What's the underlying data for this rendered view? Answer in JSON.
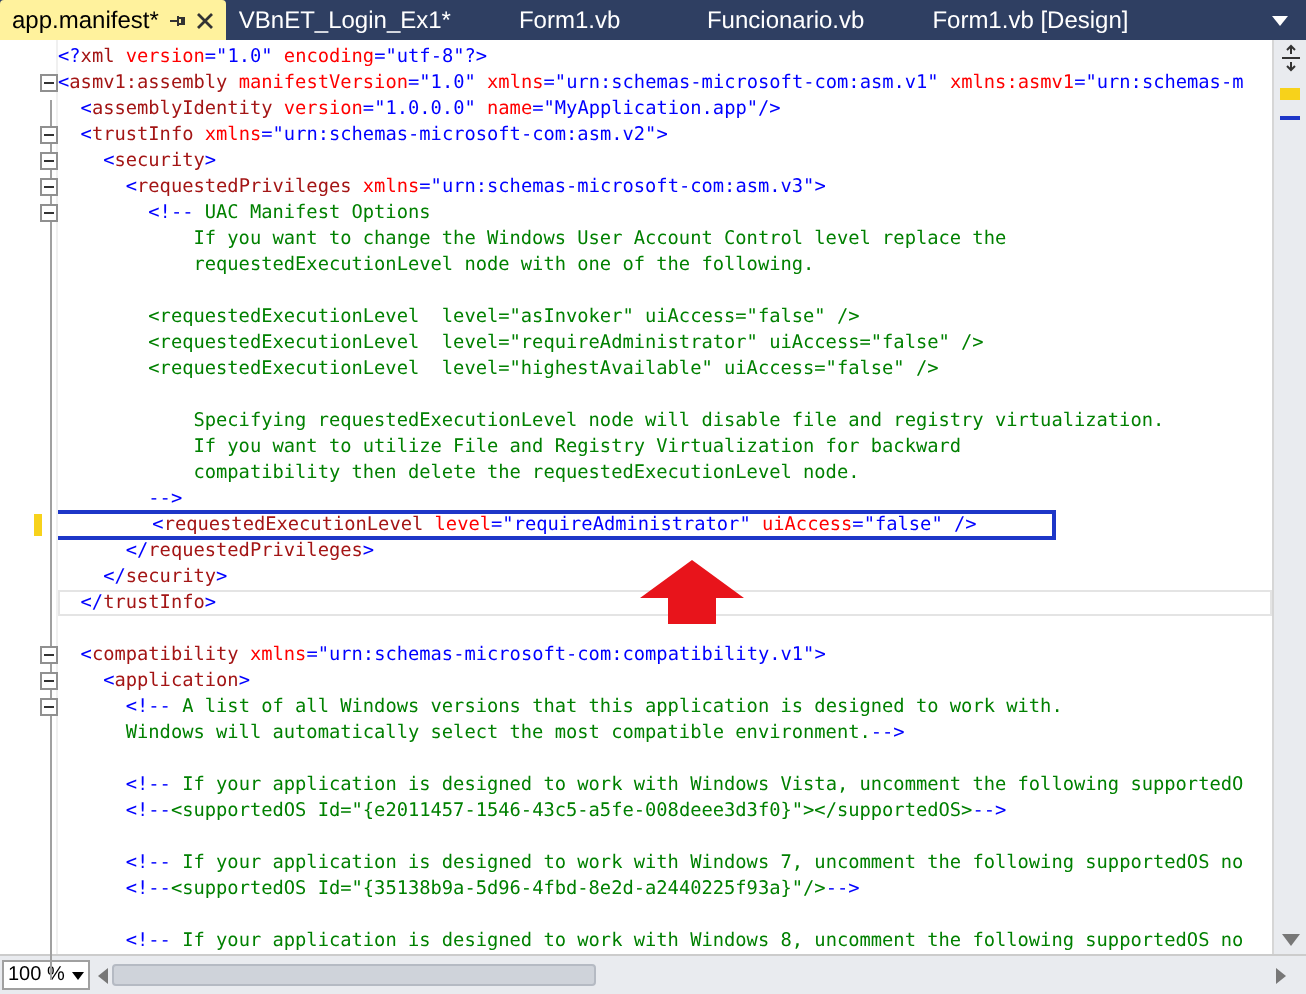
{
  "tabs": [
    {
      "label": "app.manifest*",
      "selected": true
    },
    {
      "label": "VBnET_Login_Ex1*",
      "selected": false
    },
    {
      "label": "Form1.vb",
      "selected": false
    },
    {
      "label": "Funcionario.vb",
      "selected": false
    },
    {
      "label": "Form1.vb [Design]",
      "selected": false
    }
  ],
  "editor": {
    "lines": [
      {
        "fold": false,
        "changed": false,
        "boxed": false,
        "current": false,
        "tokens": [
          {
            "kind": "delim",
            "text": "<?"
          },
          {
            "kind": "tag",
            "text": "xml"
          },
          {
            "kind": "attr",
            "text": " version"
          },
          {
            "kind": "delim",
            "text": "="
          },
          {
            "kind": "value",
            "text": "\"1.0\""
          },
          {
            "kind": "attr",
            "text": " encoding"
          },
          {
            "kind": "delim",
            "text": "="
          },
          {
            "kind": "value",
            "text": "\"utf-8\""
          },
          {
            "kind": "delim",
            "text": "?>"
          }
        ]
      },
      {
        "fold": true,
        "changed": false,
        "boxed": false,
        "current": false,
        "tokens": [
          {
            "kind": "delim",
            "text": "<"
          },
          {
            "kind": "tag",
            "text": "asmv1:assembly"
          },
          {
            "kind": "attr",
            "text": " manifestVersion"
          },
          {
            "kind": "delim",
            "text": "="
          },
          {
            "kind": "value",
            "text": "\"1.0\""
          },
          {
            "kind": "attr",
            "text": " xmlns"
          },
          {
            "kind": "delim",
            "text": "="
          },
          {
            "kind": "value",
            "text": "\"urn:schemas-microsoft-com:asm.v1\""
          },
          {
            "kind": "attr",
            "text": " xmlns:asmv1"
          },
          {
            "kind": "delim",
            "text": "="
          },
          {
            "kind": "value",
            "text": "\"urn:schemas-m"
          }
        ]
      },
      {
        "fold": false,
        "changed": false,
        "boxed": false,
        "current": false,
        "tokens": [
          {
            "kind": "delim",
            "text": "  <"
          },
          {
            "kind": "tag",
            "text": "assemblyIdentity"
          },
          {
            "kind": "attr",
            "text": " version"
          },
          {
            "kind": "delim",
            "text": "="
          },
          {
            "kind": "value",
            "text": "\"1.0.0.0\""
          },
          {
            "kind": "attr",
            "text": " name"
          },
          {
            "kind": "delim",
            "text": "="
          },
          {
            "kind": "value",
            "text": "\"MyApplication.app\""
          },
          {
            "kind": "delim",
            "text": "/>"
          }
        ]
      },
      {
        "fold": true,
        "changed": false,
        "boxed": false,
        "current": false,
        "tokens": [
          {
            "kind": "delim",
            "text": "  <"
          },
          {
            "kind": "tag",
            "text": "trustInfo"
          },
          {
            "kind": "attr",
            "text": " xmlns"
          },
          {
            "kind": "delim",
            "text": "="
          },
          {
            "kind": "value",
            "text": "\"urn:schemas-microsoft-com:asm.v2\""
          },
          {
            "kind": "delim",
            "text": ">"
          }
        ]
      },
      {
        "fold": true,
        "changed": false,
        "boxed": false,
        "current": false,
        "tokens": [
          {
            "kind": "delim",
            "text": "    <"
          },
          {
            "kind": "tag",
            "text": "security"
          },
          {
            "kind": "delim",
            "text": ">"
          }
        ]
      },
      {
        "fold": true,
        "changed": false,
        "boxed": false,
        "current": false,
        "tokens": [
          {
            "kind": "delim",
            "text": "      <"
          },
          {
            "kind": "tag",
            "text": "requestedPrivileges"
          },
          {
            "kind": "attr",
            "text": " xmlns"
          },
          {
            "kind": "delim",
            "text": "="
          },
          {
            "kind": "value",
            "text": "\"urn:schemas-microsoft-com:asm.v3\""
          },
          {
            "kind": "delim",
            "text": ">"
          }
        ]
      },
      {
        "fold": true,
        "changed": false,
        "boxed": false,
        "current": false,
        "tokens": [
          {
            "kind": "delim",
            "text": "        <!--"
          },
          {
            "kind": "comment",
            "text": " UAC Manifest Options"
          }
        ]
      },
      {
        "fold": false,
        "changed": false,
        "boxed": false,
        "current": false,
        "tokens": [
          {
            "kind": "comment",
            "text": "            If you want to change the Windows User Account Control level replace the"
          }
        ]
      },
      {
        "fold": false,
        "changed": false,
        "boxed": false,
        "current": false,
        "tokens": [
          {
            "kind": "comment",
            "text": "            requestedExecutionLevel node with one of the following."
          }
        ]
      },
      {
        "fold": false,
        "changed": false,
        "boxed": false,
        "current": false
      },
      {
        "fold": false,
        "changed": false,
        "boxed": false,
        "current": false,
        "tokens": [
          {
            "kind": "comment",
            "text": "        <requestedExecutionLevel  level=\"asInvoker\" uiAccess=\"false\" />"
          }
        ]
      },
      {
        "fold": false,
        "changed": false,
        "boxed": false,
        "current": false,
        "tokens": [
          {
            "kind": "comment",
            "text": "        <requestedExecutionLevel  level=\"requireAdministrator\" uiAccess=\"false\" />"
          }
        ]
      },
      {
        "fold": false,
        "changed": false,
        "boxed": false,
        "current": false,
        "tokens": [
          {
            "kind": "comment",
            "text": "        <requestedExecutionLevel  level=\"highestAvailable\" uiAccess=\"false\" />"
          }
        ]
      },
      {
        "fold": false,
        "changed": false,
        "boxed": false,
        "current": false
      },
      {
        "fold": false,
        "changed": false,
        "boxed": false,
        "current": false,
        "tokens": [
          {
            "kind": "comment",
            "text": "            Specifying requestedExecutionLevel node will disable file and registry virtualization."
          }
        ]
      },
      {
        "fold": false,
        "changed": false,
        "boxed": false,
        "current": false,
        "tokens": [
          {
            "kind": "comment",
            "text": "            If you want to utilize File and Registry Virtualization for backward"
          }
        ]
      },
      {
        "fold": false,
        "changed": false,
        "boxed": false,
        "current": false,
        "tokens": [
          {
            "kind": "comment",
            "text": "            compatibility then delete the requestedExecutionLevel node."
          }
        ]
      },
      {
        "fold": false,
        "changed": false,
        "boxed": false,
        "current": false,
        "tokens": [
          {
            "kind": "delim",
            "text": "        -->"
          }
        ]
      },
      {
        "fold": false,
        "changed": true,
        "boxed": true,
        "current": false,
        "tokens": [
          {
            "kind": "delim",
            "text": "        <"
          },
          {
            "kind": "tag",
            "text": "requestedExecutionLevel"
          },
          {
            "kind": "attr",
            "text": " level"
          },
          {
            "kind": "delim",
            "text": "="
          },
          {
            "kind": "value",
            "text": "\"requireAdministrator\""
          },
          {
            "kind": "attr",
            "text": " uiAccess"
          },
          {
            "kind": "delim",
            "text": "="
          },
          {
            "kind": "value",
            "text": "\"false\""
          },
          {
            "kind": "delim",
            "text": " />"
          }
        ]
      },
      {
        "fold": false,
        "changed": false,
        "boxed": false,
        "current": false,
        "tokens": [
          {
            "kind": "delim",
            "text": "      </"
          },
          {
            "kind": "tag",
            "text": "requestedPrivileges"
          },
          {
            "kind": "delim",
            "text": ">"
          }
        ]
      },
      {
        "fold": false,
        "changed": false,
        "boxed": false,
        "current": false,
        "tokens": [
          {
            "kind": "delim",
            "text": "    </"
          },
          {
            "kind": "tag",
            "text": "security"
          },
          {
            "kind": "delim",
            "text": ">"
          }
        ]
      },
      {
        "fold": false,
        "changed": false,
        "boxed": false,
        "current": true,
        "tokens": [
          {
            "kind": "delim",
            "text": "  </"
          },
          {
            "kind": "tag",
            "text": "trustInfo"
          },
          {
            "kind": "delim",
            "text": ">"
          }
        ]
      },
      {
        "fold": false,
        "changed": false,
        "boxed": false,
        "current": false
      },
      {
        "fold": true,
        "changed": false,
        "boxed": false,
        "current": false,
        "tokens": [
          {
            "kind": "delim",
            "text": "  <"
          },
          {
            "kind": "tag",
            "text": "compatibility"
          },
          {
            "kind": "attr",
            "text": " xmlns"
          },
          {
            "kind": "delim",
            "text": "="
          },
          {
            "kind": "value",
            "text": "\"urn:schemas-microsoft-com:compatibility.v1\""
          },
          {
            "kind": "delim",
            "text": ">"
          }
        ]
      },
      {
        "fold": true,
        "changed": false,
        "boxed": false,
        "current": false,
        "tokens": [
          {
            "kind": "delim",
            "text": "    <"
          },
          {
            "kind": "tag",
            "text": "application"
          },
          {
            "kind": "delim",
            "text": ">"
          }
        ]
      },
      {
        "fold": true,
        "changed": false,
        "boxed": false,
        "current": false,
        "tokens": [
          {
            "kind": "delim",
            "text": "      <!--"
          },
          {
            "kind": "comment",
            "text": " A list of all Windows versions that this application is designed to work with."
          }
        ]
      },
      {
        "fold": false,
        "changed": false,
        "boxed": false,
        "current": false,
        "tokens": [
          {
            "kind": "comment",
            "text": "      Windows will automatically select the most compatible environment."
          },
          {
            "kind": "delim",
            "text": "-->"
          }
        ]
      },
      {
        "fold": false,
        "changed": false,
        "boxed": false,
        "current": false
      },
      {
        "fold": false,
        "changed": false,
        "boxed": false,
        "current": false,
        "tokens": [
          {
            "kind": "delim",
            "text": "      <!--"
          },
          {
            "kind": "comment",
            "text": " If your application is designed to work with Windows Vista, uncomment the following supportedO"
          }
        ]
      },
      {
        "fold": false,
        "changed": false,
        "boxed": false,
        "current": false,
        "tokens": [
          {
            "kind": "delim",
            "text": "      <!--"
          },
          {
            "kind": "comment",
            "text": "<supportedOS Id=\"{e2011457-1546-43c5-a5fe-008deee3d3f0}\"></supportedOS>"
          },
          {
            "kind": "delim",
            "text": "-->"
          }
        ]
      },
      {
        "fold": false,
        "changed": false,
        "boxed": false,
        "current": false
      },
      {
        "fold": false,
        "changed": false,
        "boxed": false,
        "current": false,
        "tokens": [
          {
            "kind": "delim",
            "text": "      <!--"
          },
          {
            "kind": "comment",
            "text": " If your application is designed to work with Windows 7, uncomment the following supportedOS no"
          }
        ]
      },
      {
        "fold": false,
        "changed": false,
        "boxed": false,
        "current": false,
        "tokens": [
          {
            "kind": "delim",
            "text": "      <!--"
          },
          {
            "kind": "comment",
            "text": "<supportedOS Id=\"{35138b9a-5d96-4fbd-8e2d-a2440225f93a}\"/>"
          },
          {
            "kind": "delim",
            "text": "-->"
          }
        ]
      },
      {
        "fold": false,
        "changed": false,
        "boxed": false,
        "current": false
      },
      {
        "fold": false,
        "changed": false,
        "boxed": false,
        "current": false,
        "tokens": [
          {
            "kind": "delim",
            "text": "      <!--"
          },
          {
            "kind": "comment",
            "text": " If your application is designed to work with Windows 8, uncomment the following supportedOS no"
          }
        ]
      }
    ]
  },
  "zoom": {
    "value": "100 %"
  }
}
